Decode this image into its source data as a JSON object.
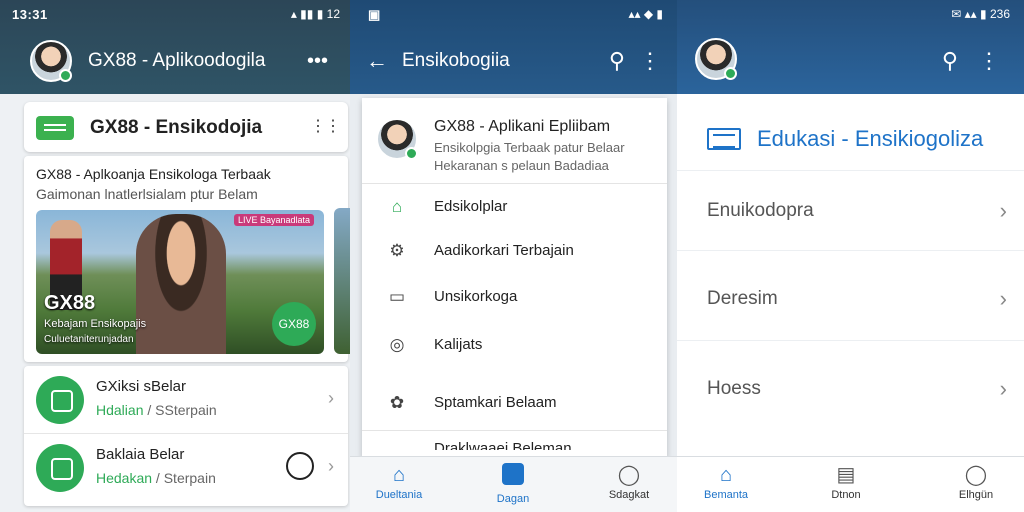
{
  "status": {
    "time": "13:31",
    "icons1": "▴ ▮▮ ▮ 12",
    "icons2": "▴▴ ◆ ▮",
    "icons3": "✉ ▴▴ ▮ 236"
  },
  "pane1": {
    "app_title": "GX88 - Aplikoodogila",
    "header_card_title": "GX88 - Ensikodojia",
    "featured_title": "GX88 - Aplkoanja Ensikologa Terbaak",
    "featured_subtitle": "Gaimonan lnatlerlsialam ptur Belam",
    "banner": {
      "live_label": "LIVE Bayanadlata",
      "brand": "GX88",
      "line1": "Kebajam Ensikopajis",
      "line2": "Culuetaniterunjadan",
      "badge": "GX88"
    },
    "list": [
      {
        "title": "GXiksi sBelar",
        "green": "Hdalian",
        "grey": " / SSterpain"
      },
      {
        "title": "Baklaia Belar",
        "green": "Hedakan",
        "grey": " / Sterpain"
      }
    ]
  },
  "pane2": {
    "title": "Ensikobogiia",
    "profile": {
      "name": "GX88 - Aplikani Epliibam",
      "desc1": "Ensikolpgia Terbaak patur Belaar",
      "desc2": "Hekaranan s pelaun Badadiaa"
    },
    "menu": [
      {
        "label": "Edsikolplar",
        "icon": "⌂"
      },
      {
        "label": "Aadikorkari Terbajain",
        "icon": "⚙"
      },
      {
        "label": "Unsikorkoga",
        "icon": "▭"
      },
      {
        "label": "Kalijats",
        "icon": "◎"
      },
      {
        "label": "Sptamkari Belaam",
        "icon": "✿"
      }
    ],
    "cut_label": "Draklwaaei Beleman",
    "bottom_nav": [
      {
        "label": "Dueltania",
        "icon": "⌂"
      },
      {
        "label": "Dagan",
        "icon": "▣"
      },
      {
        "label": "Sdagkat",
        "icon": "◯"
      }
    ]
  },
  "pane3": {
    "title": "Edukasi - Ensikiogoliza",
    "rows": [
      "Enuikodopra",
      "Deresim",
      "Hoess"
    ],
    "bottom_nav": [
      {
        "label": "Bemanta",
        "icon": "⌂"
      },
      {
        "label": "Dtnon",
        "icon": "▤"
      },
      {
        "label": "Elhgün",
        "icon": "◯"
      }
    ]
  },
  "colors": {
    "accent_green": "#2eaa57",
    "accent_blue": "#1e73c8"
  }
}
